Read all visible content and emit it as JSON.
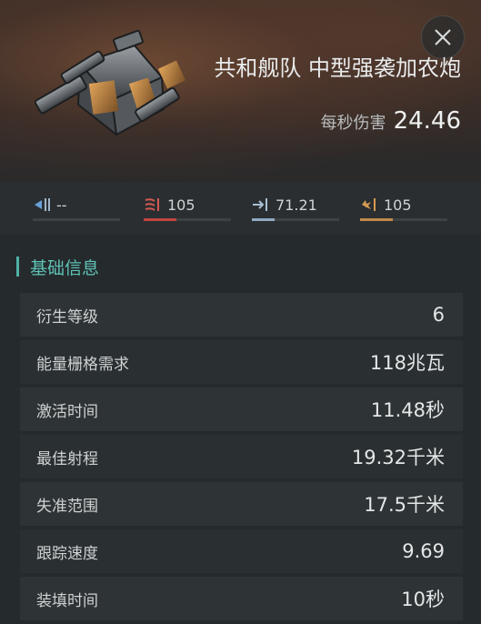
{
  "header": {
    "title": "共和舰队 中型强袭加农炮",
    "dps_label": "每秒伤害",
    "dps_value": "24.46"
  },
  "close_icon": "close-icon",
  "damage_types": [
    {
      "name": "em",
      "icon": "em-damage-icon",
      "value": "--",
      "fill_fraction": 0.0,
      "color": "#3c4143"
    },
    {
      "name": "thermal",
      "icon": "thermal-damage-icon",
      "value": "105",
      "fill_fraction": 0.38,
      "color": "#c0453f"
    },
    {
      "name": "kinetic",
      "icon": "kinetic-damage-icon",
      "value": "71.21",
      "fill_fraction": 0.26,
      "color": "#8fa9c4"
    },
    {
      "name": "explosive",
      "icon": "explosive-damage-icon",
      "value": "105",
      "fill_fraction": 0.38,
      "color": "#c08a4a"
    }
  ],
  "section": {
    "title": "基础信息",
    "accent_color": "#5fc3b6"
  },
  "attributes": [
    {
      "label": "衍生等级",
      "value": "6"
    },
    {
      "label": "能量栅格需求",
      "value": "118兆瓦"
    },
    {
      "label": "激活时间",
      "value": "11.48秒"
    },
    {
      "label": "最佳射程",
      "value": "19.32千米"
    },
    {
      "label": "失准范围",
      "value": "17.5千米"
    },
    {
      "label": "跟踪速度",
      "value": "9.69"
    },
    {
      "label": "装填时间",
      "value": "10秒"
    }
  ]
}
